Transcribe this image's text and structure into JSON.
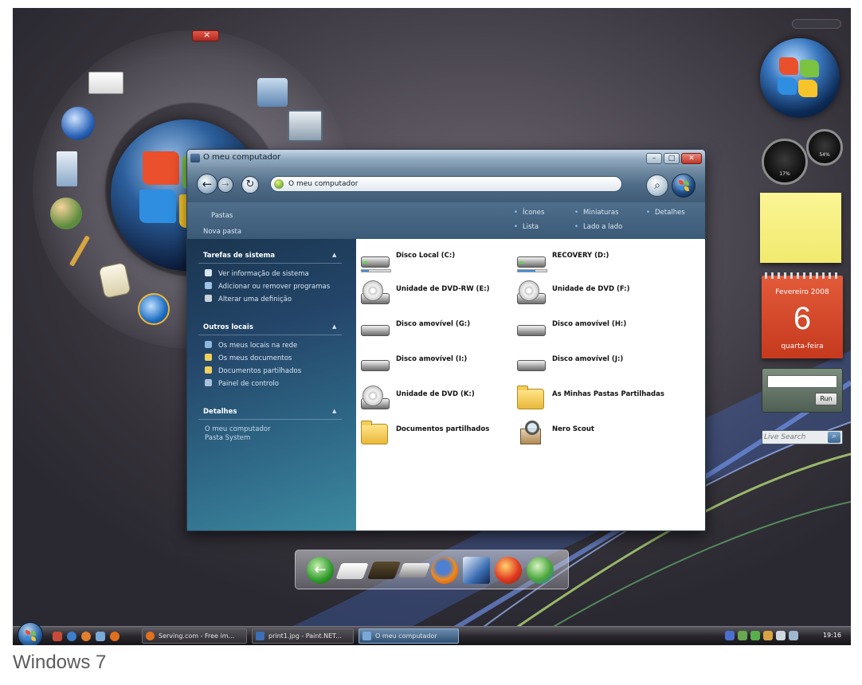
{
  "window": {
    "title": "O meu computador",
    "address": "O meu computador",
    "commands": {
      "pastas": "Pastas",
      "nova_pasta": "Nova pasta"
    },
    "views": {
      "icones": "Ícones",
      "miniaturas": "Miniaturas",
      "detalhes": "Detalhes",
      "lista": "Lista",
      "lado_a_lado": "Lado a lado"
    }
  },
  "sidebar": {
    "system_tasks": {
      "title": "Tarefas de sistema",
      "items": [
        "Ver informação de sistema",
        "Adicionar ou remover programas",
        "Alterar uma definição"
      ]
    },
    "other_places": {
      "title": "Outros locais",
      "items": [
        "Os meus locais na rede",
        "Os meus documentos",
        "Documentos partilhados",
        "Painel de controlo"
      ]
    },
    "details": {
      "title": "Detalhes",
      "name": "O meu computador",
      "type": "Pasta System"
    }
  },
  "items": [
    {
      "label": "Disco Local (C:)",
      "icon": "hard-drive-icon"
    },
    {
      "label": "RECOVERY (D:)",
      "icon": "hard-drive-icon"
    },
    {
      "label": "Unidade de DVD-RW (E:)",
      "icon": "dvd-drive-icon"
    },
    {
      "label": "Unidade de DVD (F:)",
      "icon": "dvd-drive-icon"
    },
    {
      "label": "Disco amovível (G:)",
      "icon": "removable-drive-icon"
    },
    {
      "label": "Disco amovível (H:)",
      "icon": "removable-drive-icon"
    },
    {
      "label": "Disco amovível (I:)",
      "icon": "removable-drive-icon"
    },
    {
      "label": "Disco amovível (J:)",
      "icon": "removable-drive-icon"
    },
    {
      "label": "Unidade de DVD (K:)",
      "icon": "dvd-drive-icon"
    },
    {
      "label": "As Minhas Pastas Partilhadas",
      "icon": "shared-folder-icon"
    },
    {
      "label": "Documentos partilhados",
      "icon": "folder-icon"
    },
    {
      "label": "Nero Scout",
      "icon": "nero-scout-icon"
    }
  ],
  "gadgets": {
    "calendar": {
      "month": "Fevereiro 2008",
      "day": "6",
      "weekday": "quarta-feira"
    },
    "run_button": "Run",
    "search_placeholder": "Live Search",
    "gauge_left": "17%",
    "gauge_right": "54%"
  },
  "taskbar": {
    "tasks": [
      "Serving.com - Free im...",
      "print1.jpg - Paint.NET...",
      "O meu computador"
    ],
    "clock": "19:16"
  },
  "caption": "Windows 7",
  "colors": {
    "accent": "#3a5a78",
    "calendar": "#d5472a",
    "note": "#f6ef80"
  }
}
